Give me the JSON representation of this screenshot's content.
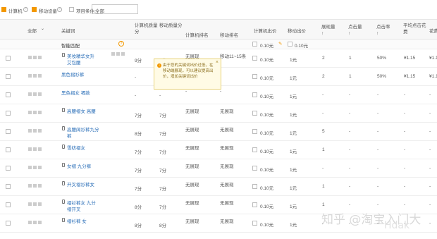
{
  "top": {
    "device_pc": "计算机",
    "device_mobile": "移动设备",
    "filter_label": "项目条件:",
    "filter_value": "全部"
  },
  "header": {
    "col_all": "全部",
    "col_keyword": "关键词",
    "col_pc_quality": "计算机质量分",
    "col_mobile_quality": "移动质量分",
    "col_pc_rank": "计算机排名",
    "col_mobile_rank": "移动排名",
    "col_pc_bid": "计算机出价",
    "col_mobile_bid": "移动出价",
    "col_impressions": "展现量",
    "col_clicks": "点击量",
    "col_ctr": "点击率",
    "col_avg_cost": "平均点击花费",
    "col_cost": "花费",
    "sort_mark": "↑",
    "dash": "-"
  },
  "smart": {
    "label": "智能匹配",
    "pc_bid": "0.10元",
    "mobile_bid": "0.10元"
  },
  "rows": [
    {
      "kw": "美妆精华女升",
      "kw2": "艾包腰",
      "pcq": "9分",
      "mq": "7分",
      "pcr": "无展现",
      "mr": "移动11~15条",
      "pcb": "0.10元",
      "mb": "1元",
      "imp": "2",
      "clk": "1",
      "ctr": "50%",
      "avg": "¥1.15",
      "cost": "¥1.15"
    },
    {
      "kw": "黑色褶衫裤",
      "kw2": "",
      "pcq": "-",
      "mq": "-",
      "pcr": "-",
      "mr": "-",
      "pcb": "0.10元",
      "mb": "1元",
      "imp": "2",
      "clk": "1",
      "ctr": "50%",
      "avg": "¥1.15",
      "cost": "¥1.15"
    },
    {
      "kw": "黑色褶女 褐款",
      "kw2": "",
      "pcq": "-",
      "mq": "-",
      "pcr": "-",
      "mr": "-",
      "pcb": "0.10元",
      "mb": "1元",
      "imp": "-",
      "clk": "-",
      "ctr": "-",
      "avg": "-",
      "cost": "-"
    },
    {
      "kw": "高腰褶女 高腰",
      "kw2": "",
      "pcq": "7分",
      "mq": "7分",
      "pcr": "无展现",
      "mr": "无展现",
      "pcb": "0.10元",
      "mb": "1元",
      "imp": "-",
      "clk": "-",
      "ctr": "-",
      "avg": "-",
      "cost": "-"
    },
    {
      "kw": "高腰阔衫裤九分",
      "kw2": "裤",
      "pcq": "8分",
      "mq": "7分",
      "pcr": "无展现",
      "mr": "无展现",
      "pcb": "0.10元",
      "mb": "1元",
      "imp": "5",
      "clk": "-",
      "ctr": "-",
      "avg": "-",
      "cost": "-"
    },
    {
      "kw": "雪纺褶女",
      "kw2": "",
      "pcq": "7分",
      "mq": "7分",
      "pcr": "无展现",
      "mr": "无展现",
      "pcb": "0.10元",
      "mb": "1元",
      "imp": "1",
      "clk": "-",
      "ctr": "-",
      "avg": "-",
      "cost": "-"
    },
    {
      "kw": "女褶 九分裤",
      "kw2": "",
      "pcq": "7分",
      "mq": "7分",
      "pcr": "无展现",
      "mr": "无展现",
      "pcb": "0.10元",
      "mb": "1元",
      "imp": "-",
      "clk": "-",
      "ctr": "-",
      "avg": "-",
      "cost": "-"
    },
    {
      "kw": "开叉褶衫裤女",
      "kw2": "",
      "pcq": "7分",
      "mq": "7分",
      "pcr": "无展现",
      "mr": "无展现",
      "pcb": "0.10元",
      "mb": "1元",
      "imp": "1",
      "clk": "-",
      "ctr": "-",
      "avg": "-",
      "cost": "-"
    },
    {
      "kw": "褶衫裤女 九分",
      "kw2": "褶开叉",
      "pcq": "8分",
      "mq": "7分",
      "pcr": "无展现",
      "mr": "无展现",
      "pcb": "0.10元",
      "mb": "1元",
      "imp": "1",
      "clk": "-",
      "ctr": "-",
      "avg": "-",
      "cost": "-"
    },
    {
      "kw": "褶衫裤 女",
      "kw2": "",
      "pcq": "8分",
      "mq": "8分",
      "pcr": "无展现",
      "mr": "无展现",
      "pcb": "0.10元",
      "mb": "1元",
      "imp": "-",
      "clk": "-",
      "ctr": "-",
      "avg": "-",
      "cost": "-"
    }
  ],
  "tooltip": {
    "text": "由于您的关键词出价过低，在移动端展现，可以建议提高出价，增加关键词出价",
    "close": "×"
  },
  "watermark": {
    "zhihu": "知乎 @淘宝入门大",
    "brand": "Hdak"
  }
}
